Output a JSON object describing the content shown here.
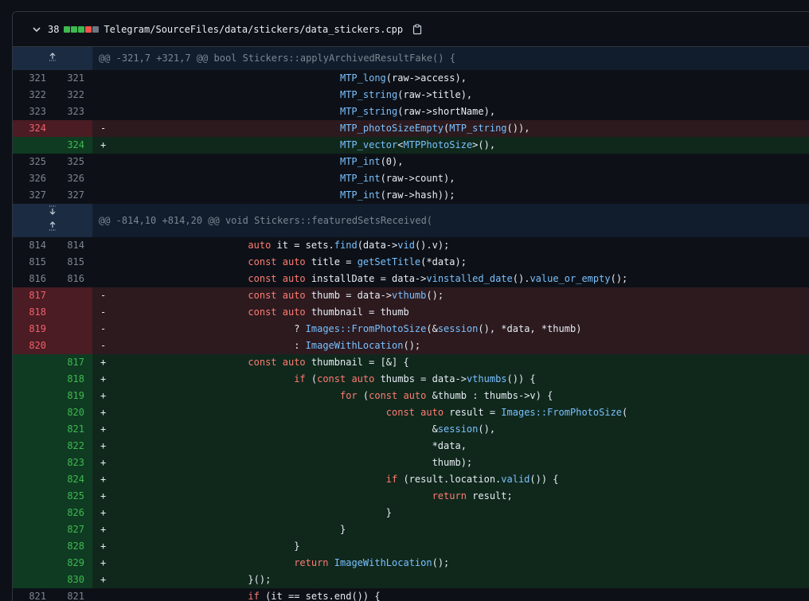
{
  "file": {
    "change_count": "38",
    "diffstat_colors": [
      "#3fb950",
      "#3fb950",
      "#3fb950",
      "#f85149",
      "#6e7681"
    ],
    "path": "Telegram/SourceFiles/data/stickers/data_stickers.cpp"
  },
  "hunks": [
    {
      "header": "@@ -321,7 +321,7 @@ bool Stickers::applyArchivedResultFake() {"
    },
    {
      "header": "@@ -814,10 +814,20 @@ void Stickers::featuredSetsReceived("
    }
  ],
  "lines": [
    {
      "old": "321",
      "new": "321",
      "sign": "",
      "text": "                                        MTP_long(raw->access),"
    },
    {
      "old": "322",
      "new": "322",
      "sign": "",
      "text": "                                        MTP_string(raw->title),"
    },
    {
      "old": "323",
      "new": "323",
      "sign": "",
      "text": "                                        MTP_string(raw->shortName),"
    },
    {
      "old": "324",
      "new": "",
      "sign": "-",
      "text": "                                        MTP_photoSizeEmpty(MTP_string()),"
    },
    {
      "old": "",
      "new": "324",
      "sign": "+",
      "text": "                                        MTP_vector<MTPPhotoSize>(),"
    },
    {
      "old": "325",
      "new": "325",
      "sign": "",
      "text": "                                        MTP_int(0),"
    },
    {
      "old": "326",
      "new": "326",
      "sign": "",
      "text": "                                        MTP_int(raw->count),"
    },
    {
      "old": "327",
      "new": "327",
      "sign": "",
      "text": "                                        MTP_int(raw->hash));"
    },
    {
      "old": "814",
      "new": "814",
      "sign": "",
      "text": "                        auto it = sets.find(data->vid().v);"
    },
    {
      "old": "815",
      "new": "815",
      "sign": "",
      "text": "                        const auto title = getSetTitle(*data);"
    },
    {
      "old": "816",
      "new": "816",
      "sign": "",
      "text": "                        const auto installDate = data->vinstalled_date().value_or_empty();"
    },
    {
      "old": "817",
      "new": "",
      "sign": "-",
      "text": "                        const auto thumb = data->vthumb();"
    },
    {
      "old": "818",
      "new": "",
      "sign": "-",
      "text": "                        const auto thumbnail = thumb"
    },
    {
      "old": "819",
      "new": "",
      "sign": "-",
      "text": "                                ? Images::FromPhotoSize(&session(), *data, *thumb)"
    },
    {
      "old": "820",
      "new": "",
      "sign": "-",
      "text": "                                : ImageWithLocation();"
    },
    {
      "old": "",
      "new": "817",
      "sign": "+",
      "text": "                        const auto thumbnail = [&] {"
    },
    {
      "old": "",
      "new": "818",
      "sign": "+",
      "text": "                                if (const auto thumbs = data->vthumbs()) {"
    },
    {
      "old": "",
      "new": "819",
      "sign": "+",
      "text": "                                        for (const auto &thumb : thumbs->v) {"
    },
    {
      "old": "",
      "new": "820",
      "sign": "+",
      "text": "                                                const auto result = Images::FromPhotoSize("
    },
    {
      "old": "",
      "new": "821",
      "sign": "+",
      "text": "                                                        &session(),"
    },
    {
      "old": "",
      "new": "822",
      "sign": "+",
      "text": "                                                        *data,"
    },
    {
      "old": "",
      "new": "823",
      "sign": "+",
      "text": "                                                        thumb);"
    },
    {
      "old": "",
      "new": "824",
      "sign": "+",
      "text": "                                                if (result.location.valid()) {"
    },
    {
      "old": "",
      "new": "825",
      "sign": "+",
      "text": "                                                        return result;"
    },
    {
      "old": "",
      "new": "826",
      "sign": "+",
      "text": "                                                }"
    },
    {
      "old": "",
      "new": "827",
      "sign": "+",
      "text": "                                        }"
    },
    {
      "old": "",
      "new": "828",
      "sign": "+",
      "text": "                                }"
    },
    {
      "old": "",
      "new": "829",
      "sign": "+",
      "text": "                                return ImageWithLocation();"
    },
    {
      "old": "",
      "new": "830",
      "sign": "+",
      "text": "                        }();"
    },
    {
      "old": "821",
      "new": "821",
      "sign": "",
      "text": "                        if (it == sets.end()) {"
    }
  ]
}
